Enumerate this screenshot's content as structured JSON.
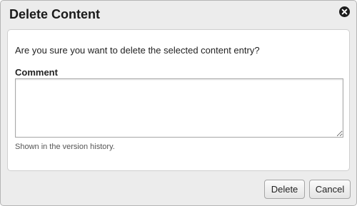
{
  "dialog": {
    "title": "Delete Content",
    "close_icon": "close-icon",
    "question": "Are you sure you want to delete the selected content entry?",
    "comment": {
      "label": "Comment",
      "value": "",
      "hint": "Shown in the version history."
    },
    "buttons": {
      "delete_label": "Delete",
      "cancel_label": "Cancel"
    }
  }
}
